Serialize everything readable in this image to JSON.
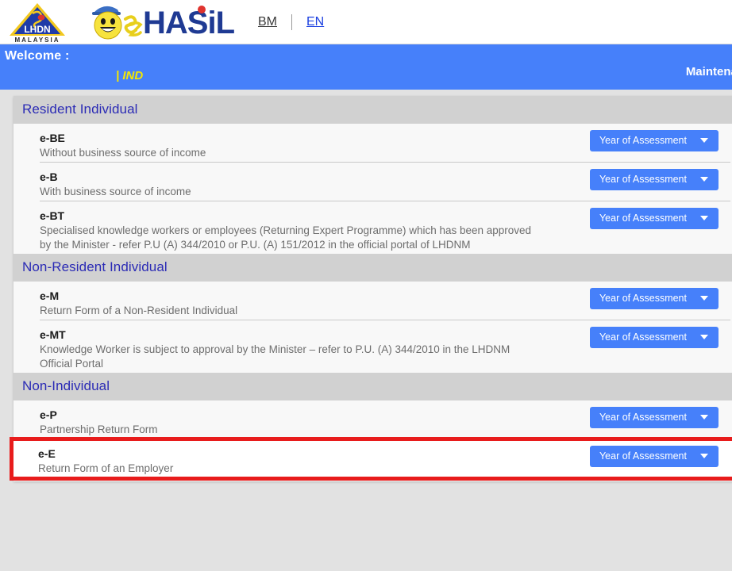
{
  "header": {
    "lhdn_logo_alt": "LHDN MALAYSIA",
    "lhdn_text": "LHDN",
    "lhdn_sub": "M A L A Y S I A",
    "hasil_logo_alt": "ez HASiL",
    "hasil_text": "HASiL",
    "hasil_prefix": "ez",
    "lang_bm": "BM",
    "lang_en": "EN"
  },
  "banner": {
    "welcome": "Welcome :",
    "user_tag": "| IND",
    "maintenance": "Maintenan"
  },
  "button": {
    "year_of_assessment": "Year of Assessment"
  },
  "sections": [
    {
      "title": "Resident Individual",
      "rows": [
        {
          "code": "e-BE",
          "desc": "Without business source of income",
          "highlight": false
        },
        {
          "code": "e-B",
          "desc": "With business source of income",
          "highlight": false
        },
        {
          "code": "e-BT",
          "desc": "Specialised knowledge workers or employees (Returning Expert Programme) which has been approved by the Minister - refer P.U (A) 344/2010 or P.U. (A) 151/2012 in the official portal of LHDNM",
          "highlight": false
        }
      ]
    },
    {
      "title": "Non-Resident Individual",
      "rows": [
        {
          "code": "e-M",
          "desc": "Return Form of a Non-Resident Individual",
          "highlight": false
        },
        {
          "code": "e-MT",
          "desc": "Knowledge Worker is subject to approval by the Minister – refer to P.U. (A) 344/2010 in the LHDNM Official Portal",
          "highlight": false
        }
      ]
    },
    {
      "title": "Non-Individual",
      "rows": [
        {
          "code": "e-P",
          "desc": "Partnership Return Form",
          "highlight": false
        },
        {
          "code": "e-E",
          "desc": "Return Form of an Employer",
          "highlight": true
        }
      ]
    }
  ],
  "colors": {
    "brand_blue": "#4680fa",
    "section_header_bg": "#d1d1d1",
    "section_header_text": "#2b2bb5",
    "highlight_red": "#e81c1c",
    "accent_yellow": "#f5e800"
  }
}
